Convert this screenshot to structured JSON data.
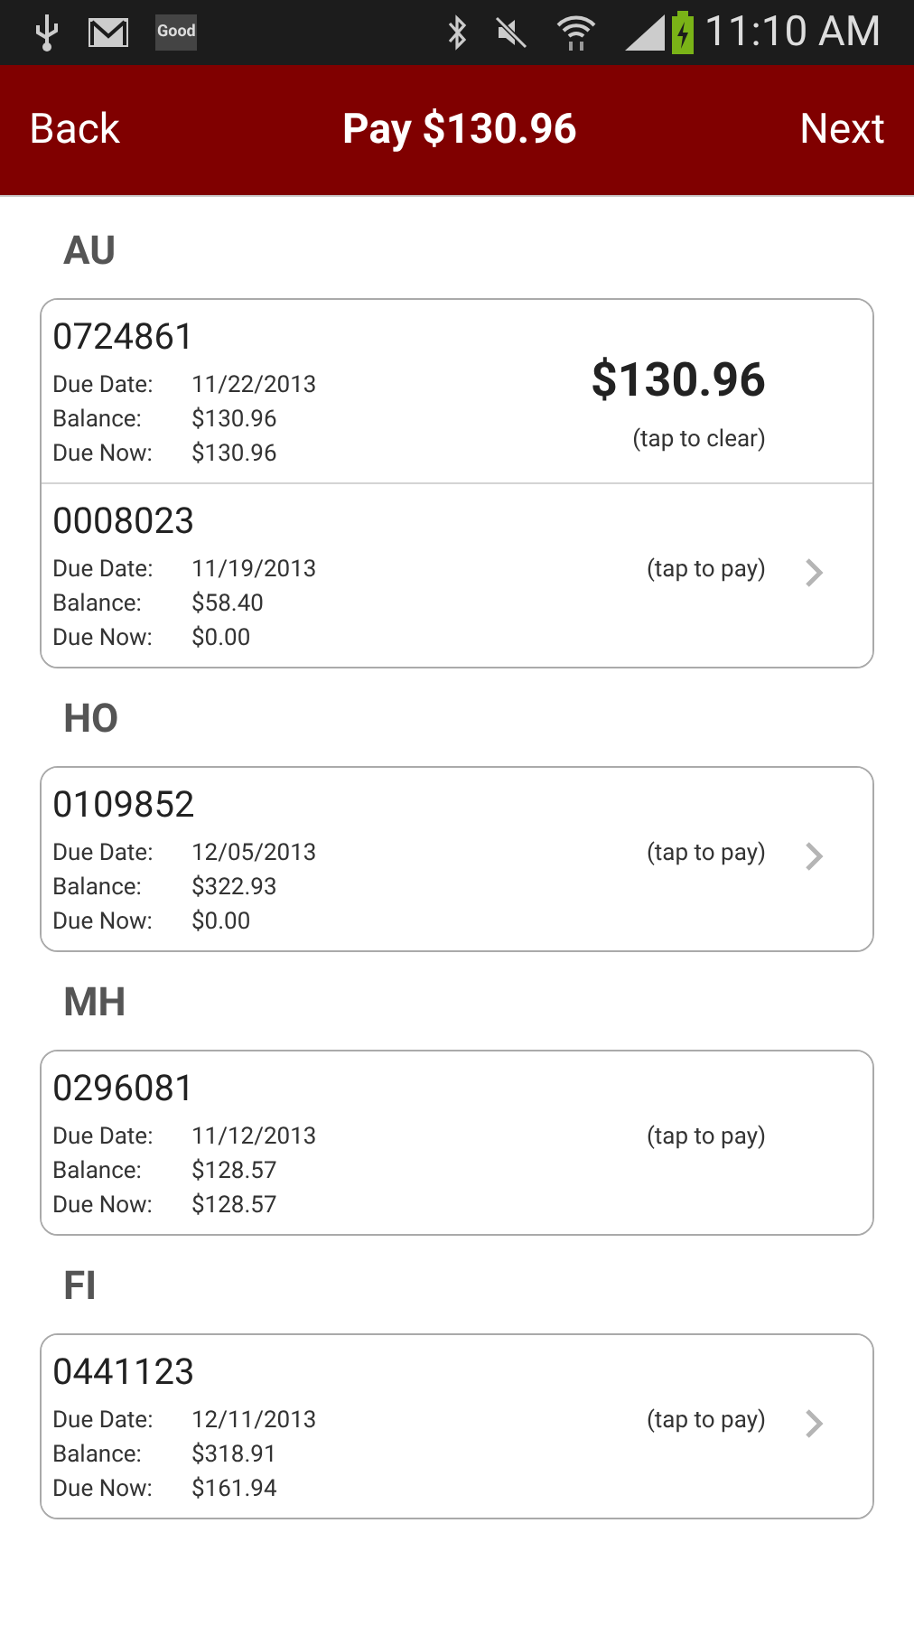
{
  "status_bar": {
    "notification_badge": "Good",
    "time": "11:10 AM"
  },
  "header": {
    "back": "Back",
    "title": "Pay $130.96",
    "next": "Next"
  },
  "groups": [
    {
      "label": "AU",
      "accounts": [
        {
          "number": "0724861",
          "selected": true,
          "amount": "$130.96",
          "hint": "(tap to clear)",
          "chevron": false,
          "fields": [
            {
              "label": "Due Date:",
              "value": "11/22/2013"
            },
            {
              "label": "Balance:",
              "value": "$130.96"
            },
            {
              "label": "Due Now:",
              "value": "$130.96"
            }
          ]
        },
        {
          "number": "0008023",
          "selected": false,
          "hint": "(tap to pay)",
          "chevron": true,
          "fields": [
            {
              "label": "Due Date:",
              "value": "11/19/2013"
            },
            {
              "label": "Balance:",
              "value": "$58.40"
            },
            {
              "label": "Due Now:",
              "value": "$0.00"
            }
          ]
        }
      ]
    },
    {
      "label": "HO",
      "accounts": [
        {
          "number": "0109852",
          "selected": false,
          "hint": "(tap to pay)",
          "chevron": true,
          "fields": [
            {
              "label": "Due Date:",
              "value": "12/05/2013"
            },
            {
              "label": "Balance:",
              "value": "$322.93"
            },
            {
              "label": "Due Now:",
              "value": "$0.00"
            }
          ]
        }
      ]
    },
    {
      "label": "MH",
      "accounts": [
        {
          "number": "0296081",
          "selected": false,
          "hint": "(tap to pay)",
          "chevron": false,
          "fields": [
            {
              "label": "Due Date:",
              "value": "11/12/2013"
            },
            {
              "label": "Balance:",
              "value": "$128.57"
            },
            {
              "label": "Due Now:",
              "value": "$128.57"
            }
          ]
        }
      ]
    },
    {
      "label": "FI",
      "accounts": [
        {
          "number": "0441123",
          "selected": false,
          "hint": "(tap to pay)",
          "chevron": true,
          "fields": [
            {
              "label": "Due Date:",
              "value": "12/11/2013"
            },
            {
              "label": "Balance:",
              "value": "$318.91"
            },
            {
              "label": "Due Now:",
              "value": "$161.94"
            }
          ]
        }
      ]
    }
  ]
}
